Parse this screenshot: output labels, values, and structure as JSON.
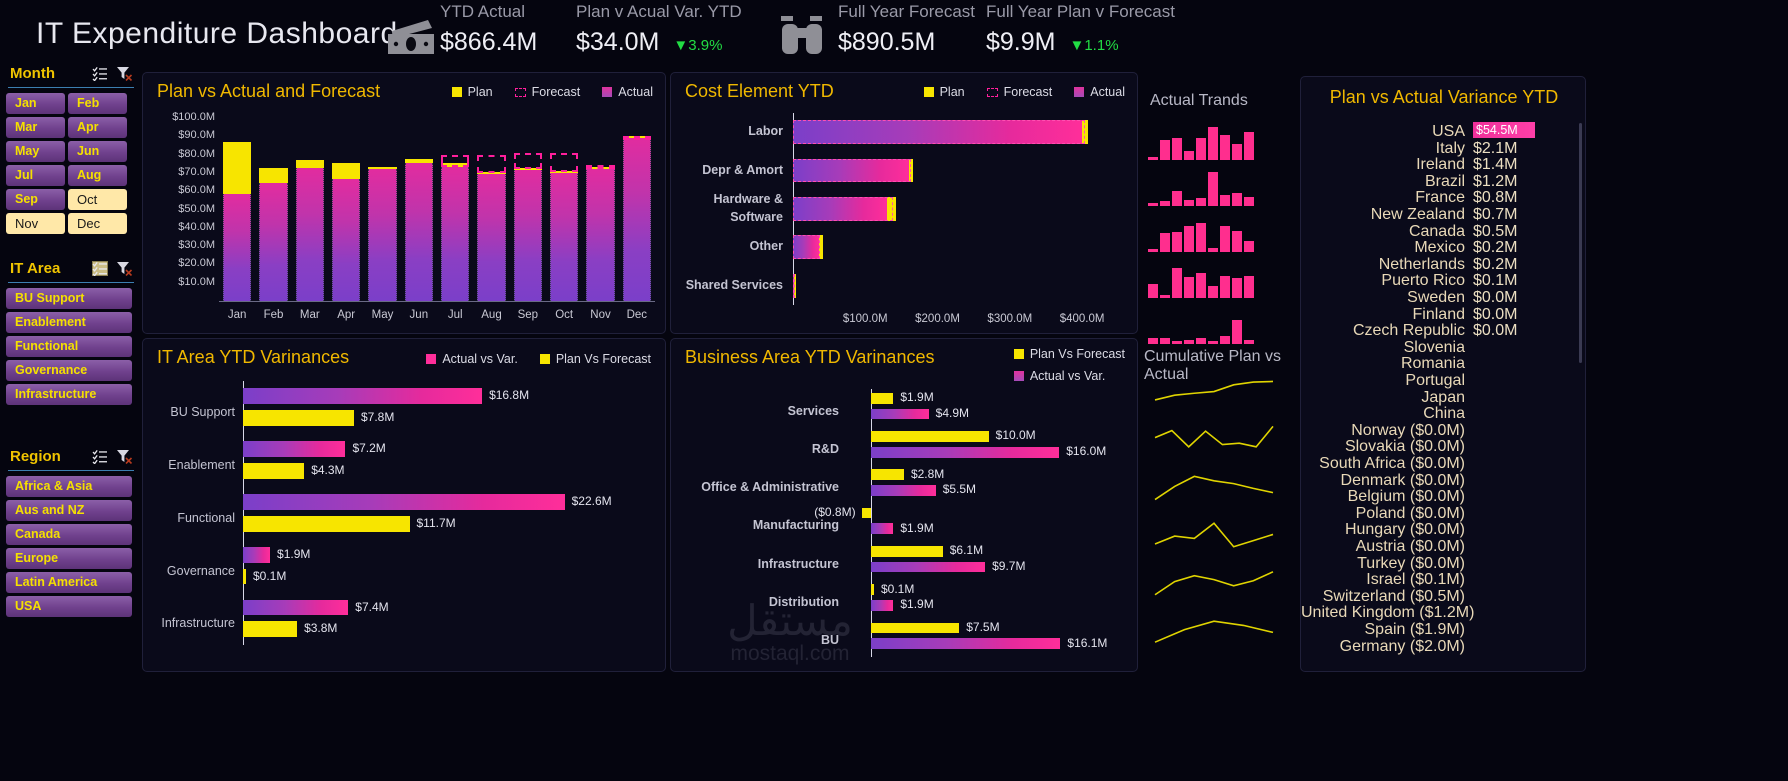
{
  "header": {
    "title": "IT Expenditure Dashboard",
    "kpis": [
      {
        "icon": "money-icon",
        "label": "YTD Actual",
        "value": "$866.4M",
        "delta": "",
        "delta_dir": ""
      },
      {
        "icon": "",
        "label": "Plan v Acual Var. YTD",
        "value": "$34.0M",
        "delta": "3.9%",
        "delta_dir": "down"
      },
      {
        "icon": "binocular-icon",
        "label": "Full Year  Forecast",
        "value": "$890.5M",
        "delta": "",
        "delta_dir": ""
      },
      {
        "icon": "",
        "label": "Full Year Plan v Forecast",
        "value": "$9.9M",
        "delta": "1.1%",
        "delta_dir": "down"
      }
    ],
    "delta_color": "#22dd44"
  },
  "slicers": [
    {
      "title": "Month",
      "multiselect_icon": "multi-select-icon",
      "clear_icon": "clear-filter-icon",
      "layout": "half",
      "items": [
        {
          "label": "Jan",
          "selected": false
        },
        {
          "label": "Feb",
          "selected": false
        },
        {
          "label": "Mar",
          "selected": false
        },
        {
          "label": "Apr",
          "selected": false
        },
        {
          "label": "May",
          "selected": false
        },
        {
          "label": "Jun",
          "selected": false
        },
        {
          "label": "Jul",
          "selected": false
        },
        {
          "label": "Aug",
          "selected": false
        },
        {
          "label": "Sep",
          "selected": false
        },
        {
          "label": "Oct",
          "selected": true
        },
        {
          "label": "Nov",
          "selected": true
        },
        {
          "label": "Dec",
          "selected": true
        }
      ]
    },
    {
      "title": "IT Area",
      "multiselect_icon": "multi-select-icon",
      "clear_icon": "clear-filter-icon",
      "layout": "full",
      "items": [
        {
          "label": "BU Support",
          "selected": false
        },
        {
          "label": "Enablement",
          "selected": false
        },
        {
          "label": "Functional",
          "selected": false
        },
        {
          "label": "Governance",
          "selected": false
        },
        {
          "label": "Infrastructure",
          "selected": false
        }
      ]
    },
    {
      "title": "Region",
      "multiselect_icon": "multi-select-icon",
      "clear_icon": "clear-filter-icon",
      "layout": "full",
      "items": [
        {
          "label": "Africa & Asia",
          "selected": false
        },
        {
          "label": "Aus and NZ",
          "selected": false
        },
        {
          "label": "Canada",
          "selected": false
        },
        {
          "label": "Europe",
          "selected": false
        },
        {
          "label": "Latin America",
          "selected": false
        },
        {
          "label": "USA",
          "selected": false
        }
      ]
    }
  ],
  "colors": {
    "plan": "#f7e500",
    "forecast": "#ff1f9c",
    "actual_start": "#7b3fc9",
    "actual_end": "#ff2e9a",
    "title": "#f0b800",
    "background": "#05050f",
    "card": "#0a0a1a",
    "positive": "#22dd44"
  },
  "chart_data": [
    {
      "id": "plan-vs-actual-forecast",
      "type": "bar",
      "title": "Plan vs Actual and Forecast",
      "legend": [
        "Plan",
        "Forecast",
        "Actual"
      ],
      "legend_position": "top-right",
      "categories": [
        "Jan",
        "Feb",
        "Mar",
        "Apr",
        "May",
        "Jun",
        "Jul",
        "Aug",
        "Sep",
        "Oct",
        "Nov",
        "Dec"
      ],
      "ylabel": "",
      "xlabel": "",
      "ylim": [
        0,
        100
      ],
      "yticks": [
        "$100.0M",
        "$90.0M",
        "$80.0M",
        "$70.0M",
        "$60.0M",
        "$50.0M",
        "$40.0M",
        "$30.0M",
        "$20.0M",
        "$10.0M"
      ],
      "series": [
        {
          "name": "Actual",
          "values": [
            58.5,
            64.5,
            73.0,
            66.5,
            72.0,
            75.5,
            73.5,
            70.0,
            72.0,
            70.5,
            72.5,
            90.0
          ]
        },
        {
          "name": "Plan",
          "values": [
            87.0,
            72.5,
            77.0,
            75.5,
            73.5,
            77.5,
            75.5,
            70.8,
            72.8,
            71.3,
            73.5,
            90.5
          ]
        },
        {
          "name": "Forecast",
          "values": [
            null,
            null,
            null,
            null,
            null,
            null,
            80.0,
            80.0,
            81.0,
            81.0,
            74.5,
            90.5
          ]
        }
      ]
    },
    {
      "id": "cost-element-ytd",
      "type": "bar",
      "orientation": "horizontal",
      "title": "Cost Element YTD",
      "legend": [
        "Plan",
        "Forecast",
        "Actual"
      ],
      "legend_position": "top-right",
      "categories": [
        "Labor",
        "Depr & Amort",
        "Hardware & Software",
        "Other",
        "Shared Services"
      ],
      "xticks": [
        "$100.0M",
        "$200.0M",
        "$300.0M",
        "$400.0M"
      ],
      "xlim": [
        0,
        440
      ],
      "series": [
        {
          "name": "Actual",
          "values": [
            400.0,
            160.0,
            130.0,
            36.0,
            1.2
          ]
        },
        {
          "name": "Plan",
          "values": [
            408.0,
            166.0,
            142.0,
            41.0,
            2.0
          ]
        },
        {
          "name": "Forecast",
          "values": [
            404.0,
            163.0,
            138.0,
            38.0,
            1.6
          ]
        }
      ]
    },
    {
      "id": "it-area-ytd-variances",
      "type": "bar",
      "orientation": "horizontal",
      "title": "IT Area YTD Varinances",
      "legend": [
        "Actual vs Var.",
        "Plan Vs Forecast"
      ],
      "legend_position": "top-right",
      "categories": [
        "BU Support",
        "Enablement",
        "Functional",
        "Governance",
        "Infrastructure"
      ],
      "series": [
        {
          "name": "Actual vs Var.",
          "values": [
            16.8,
            7.2,
            22.6,
            1.9,
            7.4
          ],
          "labels": [
            "$16.8M",
            "$7.2M",
            "$22.6M",
            "$1.9M",
            "$7.4M"
          ]
        },
        {
          "name": "Plan Vs Forecast",
          "values": [
            7.8,
            4.3,
            11.7,
            0.1,
            3.8
          ],
          "labels": [
            "$7.8M",
            "$4.3M",
            "$11.7M",
            "$0.1M",
            "$3.8M"
          ]
        }
      ]
    },
    {
      "id": "business-area-ytd-variances",
      "type": "bar",
      "orientation": "horizontal",
      "title": "Business Area YTD Varinances",
      "legend": [
        "Plan Vs Forecast",
        "Actual vs Var."
      ],
      "legend_position": "top-right",
      "categories": [
        "Services",
        "R&D",
        "Office & Administrative",
        "Manufacturing",
        "Infrastructure",
        "Distribution",
        "BU"
      ],
      "series": [
        {
          "name": "Plan Vs Forecast",
          "values": [
            1.9,
            10.0,
            2.8,
            -0.8,
            6.1,
            0.1,
            7.5
          ],
          "labels": [
            "$1.9M",
            "$10.0M",
            "$2.8M",
            "($0.8M)",
            "$6.1M",
            "$0.1M",
            "$7.5M"
          ]
        },
        {
          "name": "Actual vs Var.",
          "values": [
            4.9,
            16.0,
            5.5,
            1.9,
            9.7,
            1.9,
            16.1
          ],
          "labels": [
            "$4.9M",
            "$16.0M",
            "$5.5M",
            "$1.9M",
            "$9.7M",
            "$1.9M",
            "$16.1M"
          ]
        }
      ]
    },
    {
      "id": "actual-trends",
      "type": "bar",
      "title": "Actual Trands",
      "rows": [
        {
          "values": [
            0.05,
            0.55,
            0.62,
            0.24,
            0.62,
            0.92,
            0.7,
            0.45,
            0.78
          ]
        },
        {
          "values": [
            0.06,
            0.14,
            0.42,
            0.17,
            0.22,
            0.95,
            0.3,
            0.36,
            0.26
          ]
        },
        {
          "values": [
            0.07,
            0.52,
            0.55,
            0.72,
            0.8,
            0.12,
            0.72,
            0.58,
            0.3
          ]
        },
        {
          "values": [
            0.38,
            0.07,
            0.82,
            0.58,
            0.7,
            0.34,
            0.6,
            0.56,
            0.62
          ]
        },
        {
          "values": [
            0.16,
            0.18,
            0.04,
            0.1,
            0.16,
            0.05,
            0.22,
            0.68,
            0.1
          ]
        }
      ]
    },
    {
      "id": "cumulative-plan-vs-actual",
      "type": "line",
      "title": "Cumulative Plan vs Actual",
      "rows": [
        {
          "values": [
            0.18,
            0.35,
            0.42,
            0.48,
            0.72,
            0.82,
            0.84
          ]
        },
        {
          "values": [
            0.55,
            0.8,
            0.22,
            0.78,
            0.3,
            0.35,
            0.22,
            0.95
          ]
        },
        {
          "values": [
            0.05,
            0.52,
            0.88,
            0.72,
            0.62,
            0.45,
            0.3
          ]
        },
        {
          "values": [
            0.18,
            0.46,
            0.38,
            0.92,
            0.08,
            0.3,
            0.52
          ]
        },
        {
          "values": [
            0.08,
            0.55,
            0.76,
            0.62,
            0.4,
            0.58,
            0.9
          ]
        },
        {
          "values": [
            0.1,
            0.55,
            0.85,
            0.7,
            0.45
          ]
        }
      ]
    }
  ],
  "variance_panel": {
    "title": "Plan vs Actual Variance YTD",
    "highlight_color": "#f0309a",
    "rows": [
      {
        "country": "USA",
        "value": "$54.5M",
        "highlighted": true
      },
      {
        "country": "Italy",
        "value": "$2.1M",
        "highlighted": false
      },
      {
        "country": "Ireland",
        "value": "$1.4M",
        "highlighted": false
      },
      {
        "country": "Brazil",
        "value": "$1.2M",
        "highlighted": false
      },
      {
        "country": "France",
        "value": "$0.8M",
        "highlighted": false
      },
      {
        "country": "New Zealand",
        "value": "$0.7M",
        "highlighted": false
      },
      {
        "country": "Canada",
        "value": "$0.5M",
        "highlighted": false
      },
      {
        "country": "Mexico",
        "value": "$0.2M",
        "highlighted": false
      },
      {
        "country": "Netherlands",
        "value": "$0.2M",
        "highlighted": false
      },
      {
        "country": "Puerto Rico",
        "value": "$0.1M",
        "highlighted": false
      },
      {
        "country": "Sweden",
        "value": "$0.0M",
        "highlighted": false
      },
      {
        "country": "Finland",
        "value": "$0.0M",
        "highlighted": false
      },
      {
        "country": "Czech Republic",
        "value": "$0.0M",
        "highlighted": false
      },
      {
        "country": "Slovenia",
        "value": "",
        "highlighted": false
      },
      {
        "country": "Romania",
        "value": "",
        "highlighted": false
      },
      {
        "country": "Portugal",
        "value": "",
        "highlighted": false
      },
      {
        "country": "Japan",
        "value": "",
        "highlighted": false
      },
      {
        "country": "China",
        "value": "",
        "highlighted": false
      },
      {
        "country": "Norway ($0.0M)",
        "value": "",
        "highlighted": false
      },
      {
        "country": "Slovakia ($0.0M)",
        "value": "",
        "highlighted": false
      },
      {
        "country": "South Africa ($0.0M)",
        "value": "",
        "highlighted": false
      },
      {
        "country": "Denmark ($0.0M)",
        "value": "",
        "highlighted": false
      },
      {
        "country": "Belgium ($0.0M)",
        "value": "",
        "highlighted": false
      },
      {
        "country": "Poland ($0.0M)",
        "value": "",
        "highlighted": false
      },
      {
        "country": "Hungary ($0.0M)",
        "value": "",
        "highlighted": false
      },
      {
        "country": "Austria ($0.0M)",
        "value": "",
        "highlighted": false
      },
      {
        "country": "Turkey ($0.0M)",
        "value": "",
        "highlighted": false
      },
      {
        "country": "Israel ($0.1M)",
        "value": "",
        "highlighted": false
      },
      {
        "country": "Switzerland ($0.5M)",
        "value": "",
        "highlighted": false
      },
      {
        "country": "United Kingdom ($1.2M)",
        "value": "",
        "highlighted": false
      },
      {
        "country": "Spain ($1.9M)",
        "value": "",
        "highlighted": false
      },
      {
        "country": "Germany ($2.0M)",
        "value": "",
        "highlighted": false
      }
    ]
  },
  "watermark": {
    "arabic": "مستقل",
    "latin": "mostaql.com"
  }
}
